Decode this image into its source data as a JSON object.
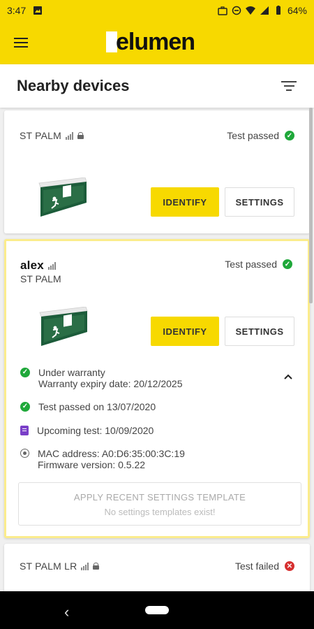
{
  "status_bar": {
    "time": "3:47",
    "battery": "64%"
  },
  "app_bar": {
    "logo": "elumen"
  },
  "page": {
    "title": "Nearby devices"
  },
  "devices": [
    {
      "name": "ST PALM",
      "status": "Test passed",
      "identify_label": "IDENTIFY",
      "settings_label": "SETTINGS"
    },
    {
      "name": "alex",
      "location": "ST PALM",
      "status": "Test passed",
      "identify_label": "IDENTIFY",
      "settings_label": "SETTINGS",
      "warranty_status": "Under warranty",
      "warranty_expiry": "Warranty expiry date: 20/12/2025",
      "test_passed": "Test passed on 13/07/2020",
      "upcoming_test": "Upcoming test: 10/09/2020",
      "mac_address": "MAC address: A0:D6:35:00:3C:19",
      "firmware_version": "Firmware version: 0.5.22",
      "template_title": "APPLY RECENT SETTINGS TEMPLATE",
      "template_sub": "No settings templates exist!"
    },
    {
      "name": "ST PALM LR",
      "status": "Test failed"
    }
  ],
  "colors": {
    "brand": "#f7d900",
    "pass": "#1fa83a",
    "fail": "#d63030",
    "calendar": "#7a3fc8",
    "selected_border": "#fbec8c"
  }
}
